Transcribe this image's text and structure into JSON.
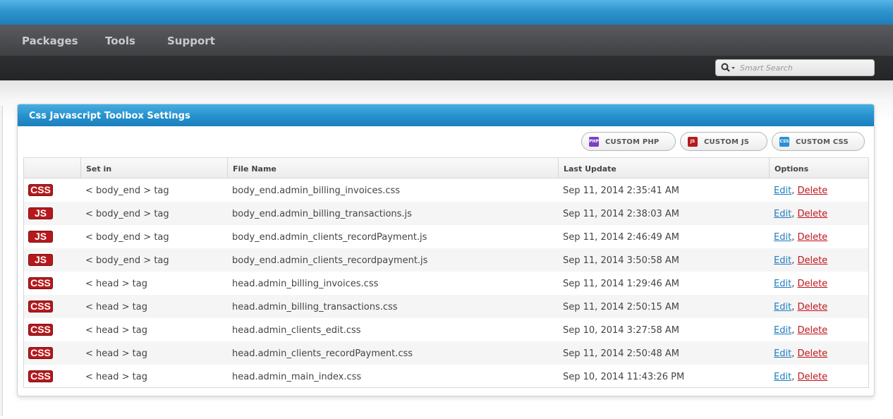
{
  "nav": {
    "items": [
      {
        "label": "Packages"
      },
      {
        "label": "Tools"
      },
      {
        "label": "Support"
      }
    ]
  },
  "search": {
    "placeholder": "Smart Search"
  },
  "panel": {
    "title": "Css Javascript Toolbox Settings"
  },
  "toolbar": {
    "buttons": [
      {
        "label": "CUSTOM PHP",
        "icon": "php-icon",
        "icon_text": "PHP",
        "color": "#7b3fc4"
      },
      {
        "label": "CUSTOM JS",
        "icon": "js-icon",
        "icon_text": "JS",
        "color": "#b5191c"
      },
      {
        "label": "CUSTOM CSS",
        "icon": "css-icon",
        "icon_text": "CSS",
        "color": "#2a8fd6"
      }
    ]
  },
  "table": {
    "headers": [
      "",
      "Set in",
      "File Name",
      "Last Update",
      "Options"
    ],
    "edit_label": "Edit",
    "delete_label": "Delete",
    "separator": ",",
    "rows": [
      {
        "type": "CSS",
        "set_in": "< body_end > tag",
        "file": "body_end.admin_billing_invoices.css",
        "updated": "Sep 11, 2014 2:35:41 AM"
      },
      {
        "type": "JS",
        "set_in": "< body_end > tag",
        "file": "body_end.admin_billing_transactions.js",
        "updated": "Sep 11, 2014 2:38:03 AM"
      },
      {
        "type": "JS",
        "set_in": "< body_end > tag",
        "file": "body_end.admin_clients_recordPayment.js",
        "updated": "Sep 11, 2014 2:46:49 AM"
      },
      {
        "type": "JS",
        "set_in": "< body_end > tag",
        "file": "body_end.admin_clients_recordpayment.js",
        "updated": "Sep 11, 2014 3:50:58 AM"
      },
      {
        "type": "CSS",
        "set_in": "< head > tag",
        "file": "head.admin_billing_invoices.css",
        "updated": "Sep 11, 2014 1:29:46 AM"
      },
      {
        "type": "CSS",
        "set_in": "< head > tag",
        "file": "head.admin_billing_transactions.css",
        "updated": "Sep 11, 2014 2:50:15 AM"
      },
      {
        "type": "CSS",
        "set_in": "< head > tag",
        "file": "head.admin_clients_edit.css",
        "updated": "Sep 10, 2014 3:27:58 AM"
      },
      {
        "type": "CSS",
        "set_in": "< head > tag",
        "file": "head.admin_clients_recordPayment.css",
        "updated": "Sep 11, 2014 2:50:48 AM"
      },
      {
        "type": "CSS",
        "set_in": "< head > tag",
        "file": "head.admin_main_index.css",
        "updated": "Sep 10, 2014 11:43:26 PM"
      }
    ]
  },
  "colors": {
    "header_blue": "#2690cc",
    "badge_red": "#b5191c",
    "link_blue": "#1e7cc0",
    "link_red": "#c0141b"
  }
}
